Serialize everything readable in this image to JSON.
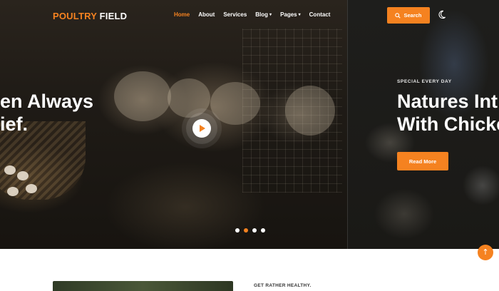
{
  "brand": {
    "part1": "POULTRY",
    "part2": " FIELD",
    "accent": "#f58220"
  },
  "nav": {
    "items": [
      {
        "label": "Home",
        "active": true,
        "dropdown": false
      },
      {
        "label": "About",
        "active": false,
        "dropdown": false
      },
      {
        "label": "Services",
        "active": false,
        "dropdown": false
      },
      {
        "label": "Blog",
        "active": false,
        "dropdown": true
      },
      {
        "label": "Pages",
        "active": false,
        "dropdown": true
      },
      {
        "label": "Contact",
        "active": false,
        "dropdown": false
      }
    ],
    "search_label": "Search",
    "search_icon": "search-icon",
    "theme_icon": "moon-icon"
  },
  "hero": {
    "prev_slide_title_line1": "en Always",
    "prev_slide_title_line2": "ief.",
    "eyebrow": "SPECIAL EVERY DAY",
    "title_line1": "Natures Int",
    "title_line2": "With Chicke",
    "cta_label": "Read More",
    "play_icon": "play-icon",
    "slides_count": 4,
    "active_slide": 2
  },
  "back_to_top_icon": "arrow-up-icon",
  "about": {
    "eyebrow": "GET RATHER HEALTHY."
  }
}
